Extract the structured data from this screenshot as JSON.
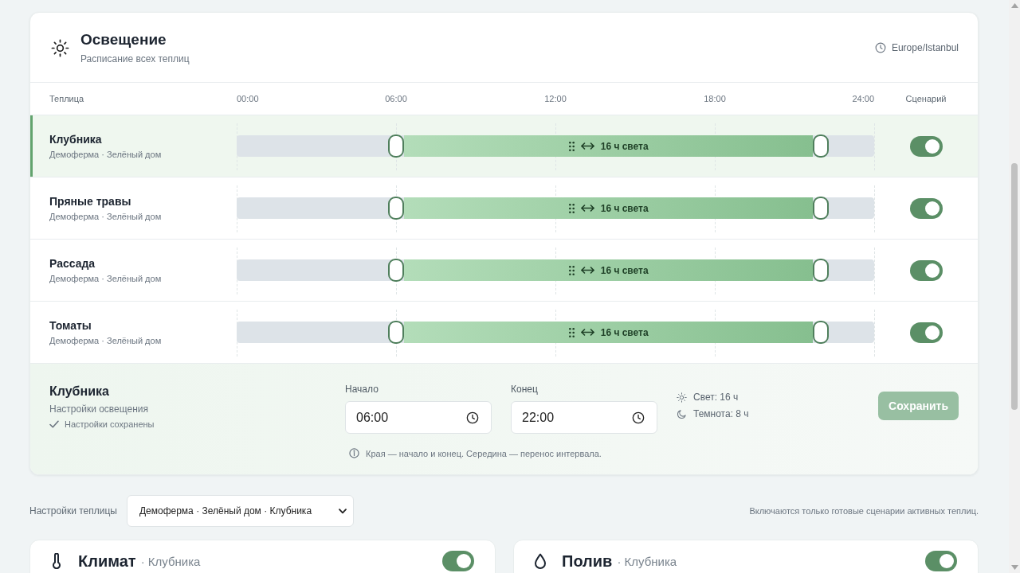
{
  "schedule": {
    "title": "Освещение",
    "subtitle": "Расписание всех теплиц",
    "timezone": "Europe/Istanbul",
    "columns": {
      "greenhouse": "Теплица",
      "scenario": "Сценарий"
    },
    "time_ticks": [
      "00:00",
      "06:00",
      "12:00",
      "18:00",
      "24:00"
    ],
    "rows": [
      {
        "name": "Клубника",
        "location": "Демоферма · Зелёный дом",
        "selected": true,
        "start_handle": {
          "level": 0.25
        },
        "end_handle": {
          "level": 0.9167
        },
        "duration": "16 ч света",
        "scenario_on": true
      },
      {
        "name": "Пряные травы",
        "location": "Демоферма · Зелёный дом",
        "selected": false,
        "start_handle": {
          "level": 0.25
        },
        "end_handle": {
          "level": 0.9167
        },
        "duration": "16 ч света",
        "scenario_on": true
      },
      {
        "name": "Рассада",
        "location": "Демоферма · Зелёный дом",
        "selected": false,
        "start_handle": {
          "level": 0.25
        },
        "end_handle": {
          "level": 0.9167
        },
        "duration": "16 ч света",
        "scenario_on": true
      },
      {
        "name": "Томаты",
        "location": "Демоферма · Зелёный дом",
        "selected": false,
        "start_handle": {
          "level": 0.25
        },
        "end_handle": {
          "level": 0.9167
        },
        "duration": "16 ч света",
        "scenario_on": true
      }
    ],
    "editor": {
      "title": "Клубника",
      "subtitle": "Настройки освещения",
      "status": "Настройки сохранены",
      "start": {
        "label": "Начало",
        "value": "06:00"
      },
      "end": {
        "label": "Конец",
        "value": "22:00"
      },
      "stats": [
        {
          "kind": "light",
          "text": "Свет: 16 ч"
        },
        {
          "kind": "dark",
          "text": "Темнота: 8 ч"
        }
      ],
      "hint": "Края — начало и конец. Середина — перенос интервала.",
      "save_button": {
        "label": "Сохранить",
        "disabled": true
      }
    }
  },
  "greenhouse_picker": {
    "label": "Настройки теплицы",
    "value": "Демоферма · Зелёный дом · Клубника",
    "note": "Включаются только готовые сценарии активных теплиц."
  },
  "cards": [
    {
      "kind": "climate",
      "title": "Климат",
      "subtitle": "· Клубника",
      "on": true
    },
    {
      "kind": "watering",
      "title": "Полив",
      "subtitle": "· Клубника",
      "on": true
    }
  ]
}
